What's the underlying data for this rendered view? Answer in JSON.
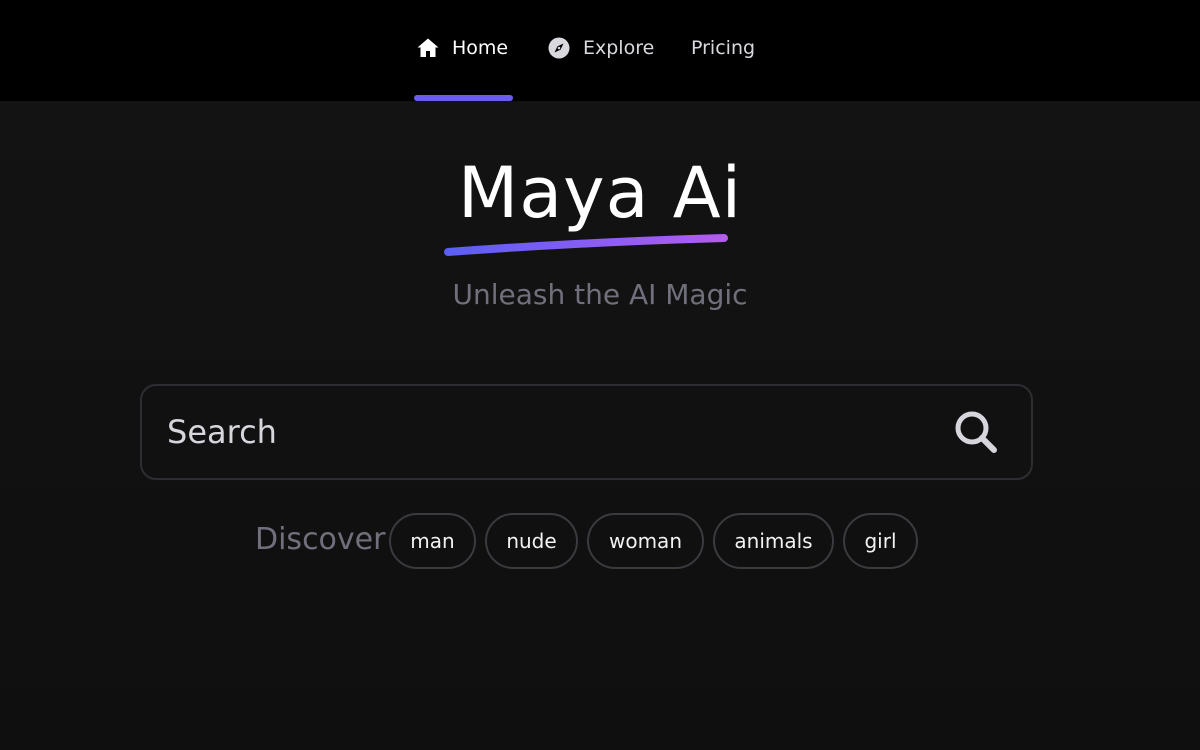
{
  "nav": {
    "items": [
      {
        "label": "Home",
        "icon": "home-icon",
        "active": true
      },
      {
        "label": "Explore",
        "icon": "compass-icon",
        "active": false
      },
      {
        "label": "Pricing",
        "icon": "",
        "active": false
      }
    ]
  },
  "hero": {
    "title": "Maya Ai",
    "tagline": "Unleash the AI Magic"
  },
  "search": {
    "placeholder": "Search",
    "value": "",
    "button_icon": "search-icon"
  },
  "discover": {
    "label": "Discover",
    "chips": [
      "man",
      "nude",
      "woman",
      "animals",
      "girl"
    ]
  },
  "colors": {
    "accent": "#6a5cf0",
    "underline_start": "#5b5ef5",
    "underline_end": "#b35cf0",
    "background": "#121212",
    "header": "#000000",
    "muted_text": "#70707c"
  }
}
